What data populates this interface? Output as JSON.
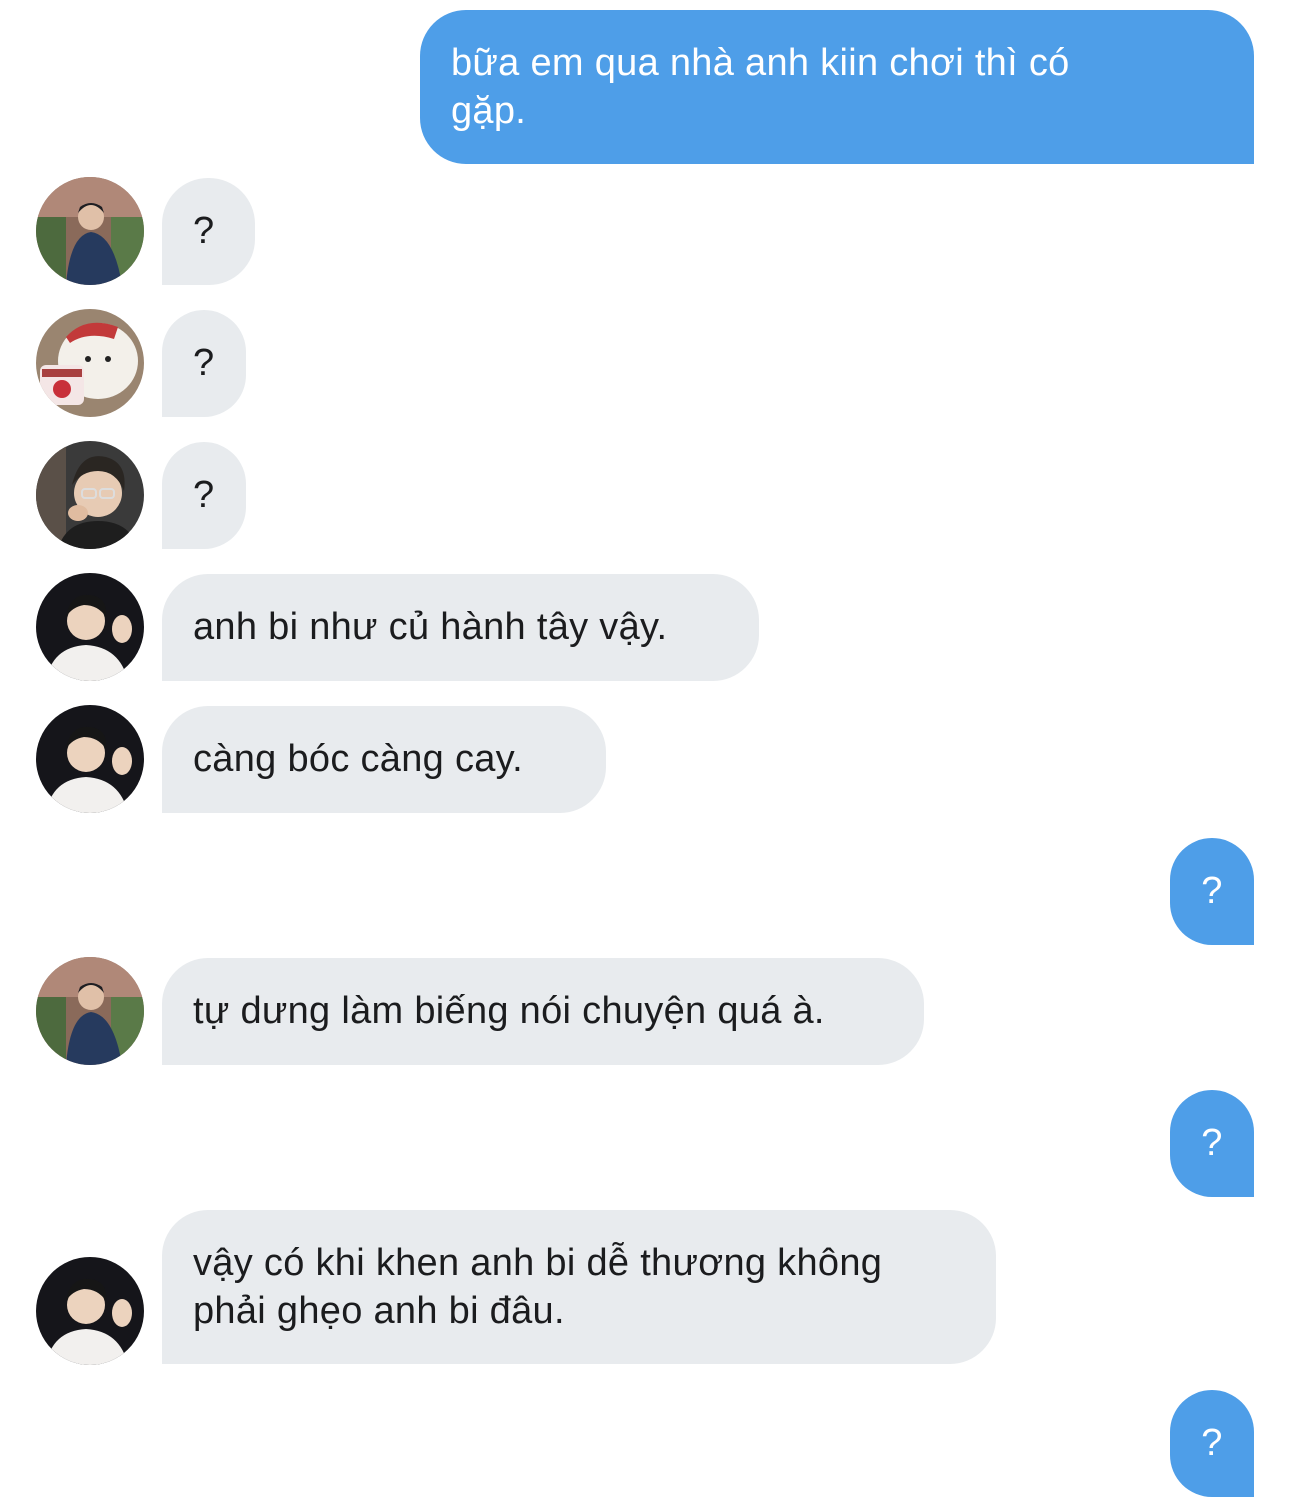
{
  "conversation": {
    "messages": [
      {
        "side": "out",
        "text": "bữa em qua nhà anh kiin chơi thì có\ngặp."
      },
      {
        "side": "in",
        "avatar": "avatar-street-man",
        "text": "?"
      },
      {
        "side": "in",
        "avatar": "avatar-cartoon-bear",
        "text": "?"
      },
      {
        "side": "in",
        "avatar": "avatar-man-glasses",
        "text": "?"
      },
      {
        "side": "in",
        "avatar": "avatar-man-waving",
        "text": "anh bi như củ hành tây vậy."
      },
      {
        "side": "in",
        "avatar": "avatar-man-waving",
        "text": "càng bóc càng cay."
      },
      {
        "side": "out",
        "text": "?"
      },
      {
        "side": "in",
        "avatar": "avatar-street-man",
        "text": "tự dưng làm biếng nói chuyện quá à."
      },
      {
        "side": "out",
        "text": "?"
      },
      {
        "side": "in",
        "avatar": "avatar-man-waving",
        "text": "vậy có khi khen anh bi dễ thương không\nphải ghẹo anh bi đâu."
      },
      {
        "side": "out",
        "text": "?"
      }
    ]
  },
  "colors": {
    "incoming_bubble": "#e8ebee",
    "outgoing_bubble": "#4e9ee8",
    "incoming_text": "#1b1c1e",
    "outgoing_text": "#ffffff"
  }
}
